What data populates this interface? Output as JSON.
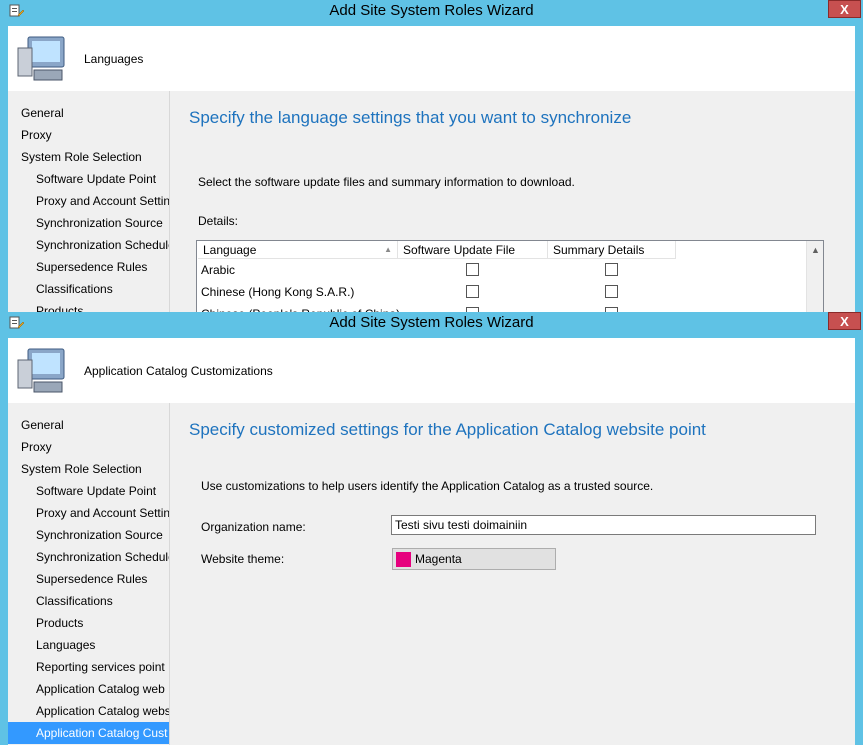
{
  "window1": {
    "title": "Add Site System Roles Wizard",
    "close": "X",
    "header": "Languages",
    "nav": [
      "General",
      "Proxy",
      "System Role Selection",
      "Software Update Point",
      "Proxy and Account Settin",
      "Synchronization Source",
      "Synchronization Schedule",
      "Supersedence Rules",
      "Classifications",
      "Products"
    ],
    "main_title": "Specify the language settings that you want to synchronize",
    "instruction": "Select the software update files and summary information to download.",
    "details_label": "Details:",
    "columns": [
      "Language",
      "Software Update File",
      "Summary Details"
    ],
    "rows": [
      "Arabic",
      "Chinese (Hong Kong S.A.R.)",
      "Chinese (People's Republic of China)"
    ]
  },
  "window2": {
    "title": "Add Site System Roles Wizard",
    "close": "X",
    "header": "Application Catalog Customizations",
    "nav": [
      "General",
      "Proxy",
      "System Role Selection",
      "Software Update Point",
      "Proxy and Account Settin",
      "Synchronization Source",
      "Synchronization Schedule",
      "Supersedence Rules",
      "Classifications",
      "Products",
      "Languages",
      "Reporting services point",
      "Application Catalog web",
      "Application Catalog webs",
      "Application Catalog Cust"
    ],
    "main_title": "Specify customized settings for the Application Catalog website point",
    "instruction": "Use customizations to help users identify the Application Catalog as a trusted source.",
    "org_label": "Organization name:",
    "org_value": "Testi sivu testi doimainiin",
    "theme_label": "Website theme:",
    "theme_value": "Magenta",
    "theme_color": "#e6007e"
  }
}
